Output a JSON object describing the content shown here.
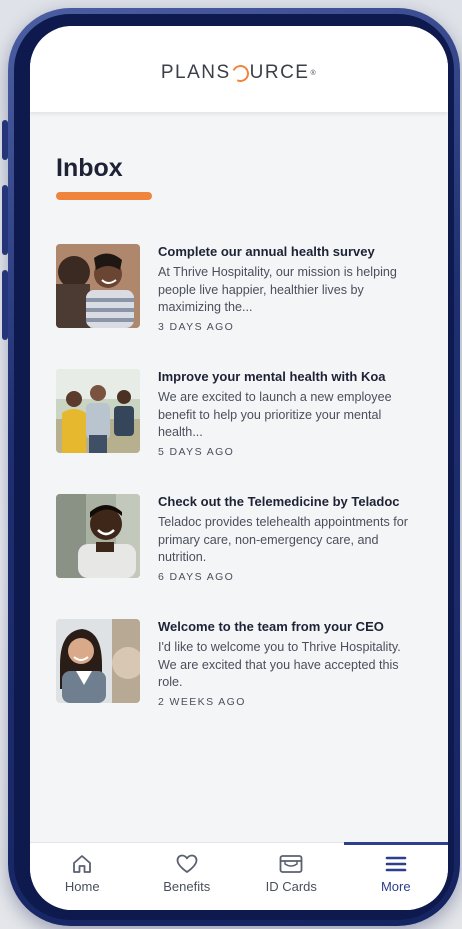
{
  "app": {
    "logo_text_left": "PLANS",
    "logo_text_right": "URCE",
    "logo_mark": "®"
  },
  "page": {
    "title": "Inbox"
  },
  "messages": [
    {
      "title": "Complete our annual health survey",
      "body": "At Thrive Hospitality, our mission is helping people live happier, healthier lives by maximizing the...",
      "time": "3 DAYS AGO",
      "image": "photo-people-laughing"
    },
    {
      "title": "Improve your mental health with Koa",
      "body": "We are excited to launch a new employee benefit to help you prioritize your mental health...",
      "time": "5 DAYS AGO",
      "image": "photo-family-outdoors"
    },
    {
      "title": "Check out the Telemedicine by Teladoc",
      "body": "Teladoc provides telehealth appointments for primary care, non-emergency care, and nutrition.",
      "time": "6 DAYS AGO",
      "image": "photo-man-smiling"
    },
    {
      "title": "Welcome to the team from your CEO",
      "body": "I'd like to welcome you to Thrive Hospitality. We are excited that you have accepted this role.",
      "time": "2 WEEKS AGO",
      "image": "photo-woman-smiling"
    }
  ],
  "tabs": [
    {
      "label": "Home",
      "icon": "home-icon"
    },
    {
      "label": "Benefits",
      "icon": "heart-icon"
    },
    {
      "label": "ID Cards",
      "icon": "id-card-icon"
    },
    {
      "label": "More",
      "icon": "menu-icon",
      "active": true
    }
  ],
  "colors": {
    "accent": "#f0843c",
    "brand": "#2c3e8c",
    "frame": "#1e2f72"
  }
}
